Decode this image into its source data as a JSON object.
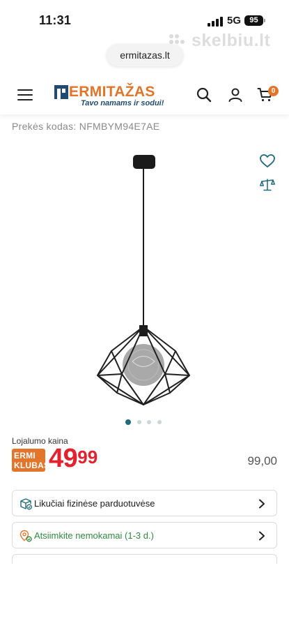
{
  "status_bar": {
    "time": "11:31",
    "network": "5G",
    "battery": "95"
  },
  "watermark": {
    "text": "skelbiu.lt"
  },
  "browser": {
    "url": "ermitazas.lt"
  },
  "header": {
    "brand_name": "ERMITAŽAS",
    "tagline": "Tavo namams ir sodui!",
    "cart_count": "0",
    "brand_color": "#e3752a",
    "brand_secondary_color": "#1f4a72"
  },
  "product": {
    "sku_label": "Prekės kodas: NFMBYM94E7AE",
    "image_alt": "pendant-lamp-black-wire-diamond",
    "gallery": {
      "total": 4,
      "active_index": 0
    }
  },
  "pricing": {
    "loyalty_label": "Lojalumo kaina",
    "badge_line1": "ERMI",
    "badge_line2": "KLUBAS",
    "price_integer": "49",
    "price_decimal": "99",
    "old_price": "99,00",
    "price_color": "#e3222e"
  },
  "info_rows": [
    {
      "label": "Likučiai fizinėse parduotuvėse",
      "icon": "store-stock-icon"
    },
    {
      "label": "Atsiimkite nemokamai (1-3 d.)",
      "icon": "pickup-location-icon",
      "color": "#2d8c3c"
    }
  ]
}
